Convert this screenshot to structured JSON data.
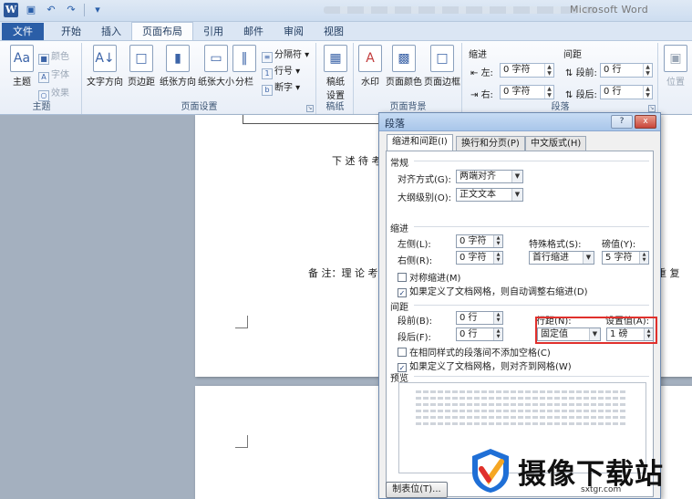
{
  "app": {
    "title": "Microsoft Word"
  },
  "ribbon_tabs": [
    "文件",
    "开始",
    "插入",
    "页面布局",
    "引用",
    "邮件",
    "审阅",
    "视图"
  ],
  "ribbon": {
    "theme": {
      "main": "主题",
      "colors": "颜色",
      "fonts": "字体",
      "effects": "效果",
      "group": "主题"
    },
    "page_setup": {
      "text_direction": "文字方向",
      "margins": "页边距",
      "orientation": "纸张方向",
      "size": "纸张大小",
      "columns": "分栏",
      "breaks": "分隔符",
      "line_numbers": "行号",
      "hyphenation": "断字",
      "group": "页面设置"
    },
    "draft": {
      "label": "稿纸\n设置",
      "group": "稿纸"
    },
    "page_background": {
      "watermark": "水印",
      "page_color": "页面颜色",
      "page_borders": "页面边框",
      "group": "页面背景"
    },
    "paragraph": {
      "indent_title": "缩进",
      "left": "左:",
      "left_value": "0 字符",
      "right": "右:",
      "right_value": "0 字符",
      "spacing_title": "间距",
      "before": "段前:",
      "before_value": "0 行",
      "after": "段后:",
      "after_value": "0 行",
      "group": "段落"
    },
    "arrange": {
      "position": "位置"
    }
  },
  "document": {
    "line1": "下 述 待 考",
    "line2": "备 注：理 论 考",
    "line2_right": "重 复"
  },
  "dialog": {
    "title": "段落",
    "help": "?",
    "close": "x",
    "tabs": [
      "缩进和间距(I)",
      "换行和分页(P)",
      "中文版式(H)"
    ],
    "general": {
      "title": "常规",
      "alignment_label": "对齐方式(G):",
      "alignment_value": "两端对齐",
      "outline_label": "大纲级别(O):",
      "outline_value": "正文文本"
    },
    "indent": {
      "title": "缩进",
      "left_label": "左侧(L):",
      "left_value": "0 字符",
      "right_label": "右侧(R):",
      "right_value": "0 字符",
      "special_label": "特殊格式(S):",
      "special_value": "首行缩进",
      "by_label": "磅值(Y):",
      "by_value": "5 字符",
      "mirror_label": "对称缩进(M)",
      "auto_right_label": "如果定义了文档网格，则自动调整右缩进(D)"
    },
    "spacing": {
      "title": "间距",
      "before_label": "段前(B):",
      "before_value": "0 行",
      "after_label": "段后(F):",
      "after_value": "0 行",
      "line_label": "行距(N):",
      "line_value": "固定值",
      "at_label": "设置值(A):",
      "at_value": "1 磅",
      "no_space_label": "在相同样式的段落间不添加空格(C)",
      "snap_label": "如果定义了文档网格，则对齐到网格(W)"
    },
    "preview_title": "预览",
    "tabs_button": "制表位(T)..."
  },
  "watermark": {
    "brand": "摄像下载站",
    "url": "sxtgr.com"
  }
}
